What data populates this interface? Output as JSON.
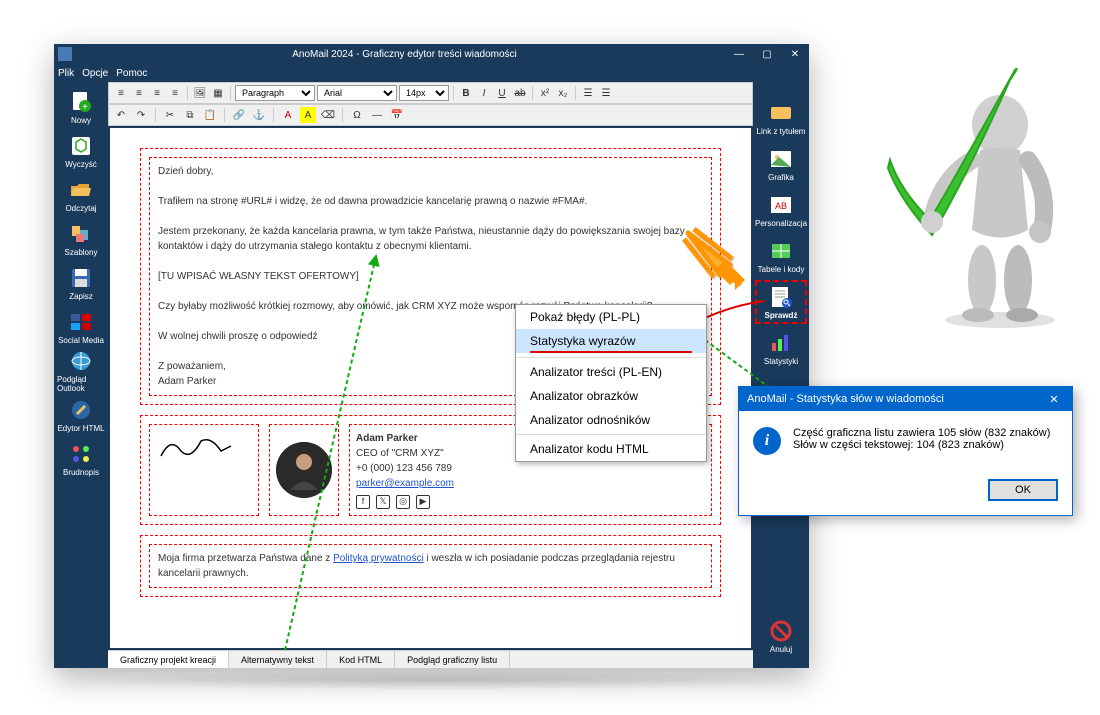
{
  "window": {
    "title": "AnoMail 2024 - Graficzny edytor treści wiadomości"
  },
  "menubar": [
    "Plik",
    "Opcje",
    "Pomoc"
  ],
  "left_sidebar": [
    {
      "label": "Nowy",
      "icon": "document-add"
    },
    {
      "label": "Wyczyść",
      "icon": "recycle"
    },
    {
      "label": "Odczytaj",
      "icon": "folder-open"
    },
    {
      "label": "Szablony",
      "icon": "templates"
    },
    {
      "label": "Zapisz",
      "icon": "floppy"
    },
    {
      "label": "Social Media",
      "icon": "social"
    },
    {
      "label": "Podgląd Outlook",
      "icon": "globe"
    },
    {
      "label": "Edytor HTML",
      "icon": "html-edit"
    },
    {
      "label": "Brudnopis",
      "icon": "draft"
    }
  ],
  "right_sidebar": [
    {
      "label": "Link z tytułem",
      "icon": "link"
    },
    {
      "label": "Grafika",
      "icon": "image"
    },
    {
      "label": "Personalizacja",
      "icon": "ab"
    },
    {
      "label": "Tabele i kody",
      "icon": "table"
    },
    {
      "label": "Sprawdź",
      "icon": "check-doc",
      "highlight": true
    },
    {
      "label": "Statystyki",
      "icon": "chart"
    },
    {
      "label": "Anuluj",
      "icon": "cancel"
    }
  ],
  "format_selects": {
    "style": "Paragraph",
    "font": "Arial",
    "size": "14px"
  },
  "email": {
    "greeting": "Dzień dobry,",
    "p1": "Trafiłem na stronę #URL# i widzę, że od dawna prowadzicie kancelarię prawną o nazwie #FMA#.",
    "p2": "Jestem przekonany, że każda kancelaria prawna, w tym także Państwa, nieustannie dąży do powiększania swojej bazy kontaktów i dąży do utrzymania stałego kontaktu z obecnymi klientami.",
    "placeholder": "[TU WPISAĆ WŁASNY TEKST OFERTOWY]",
    "p3": "Czy byłaby możliwość krótkiej rozmowy, aby omówić, jak CRM XYZ może wspomóc rozwój Państwa kancelarii?",
    "p4": "W wolnej chwili proszę o odpowiedź",
    "closing": "Z poważaniem,",
    "signer": "Adam Parker",
    "sig_name": "Adam Parker",
    "sig_title": "CEO of \"CRM XYZ\"",
    "sig_phone": "+0 (000) 123 456 789",
    "sig_email": "parker@example.com",
    "footer_pre": "Moja firma przetwarza Państwa dane z ",
    "footer_link": "Polityką prywatności",
    "footer_post": " i weszła w ich posiadanie podczas przeglądania rejestru kancelarii prawnych."
  },
  "footer_tabs": [
    "Graficzny projekt kreacji",
    "Alternatywny tekst",
    "Kod HTML",
    "Podgląd graficzny listu"
  ],
  "context_menu": [
    "Pokaż błędy (PL-PL)",
    "Statystyka wyrazów",
    "Analizator treści (PL-EN)",
    "Analizator obrazków",
    "Analizator odnośników",
    "Analizator kodu HTML"
  ],
  "dialog": {
    "title": "AnoMail - Statystyka słów w wiadomości",
    "line1": "Część graficzna listu zawiera 105 słów (832 znaków)",
    "line2": "Słów w części tekstowej: 104 (823 znaków)",
    "ok": "OK"
  }
}
